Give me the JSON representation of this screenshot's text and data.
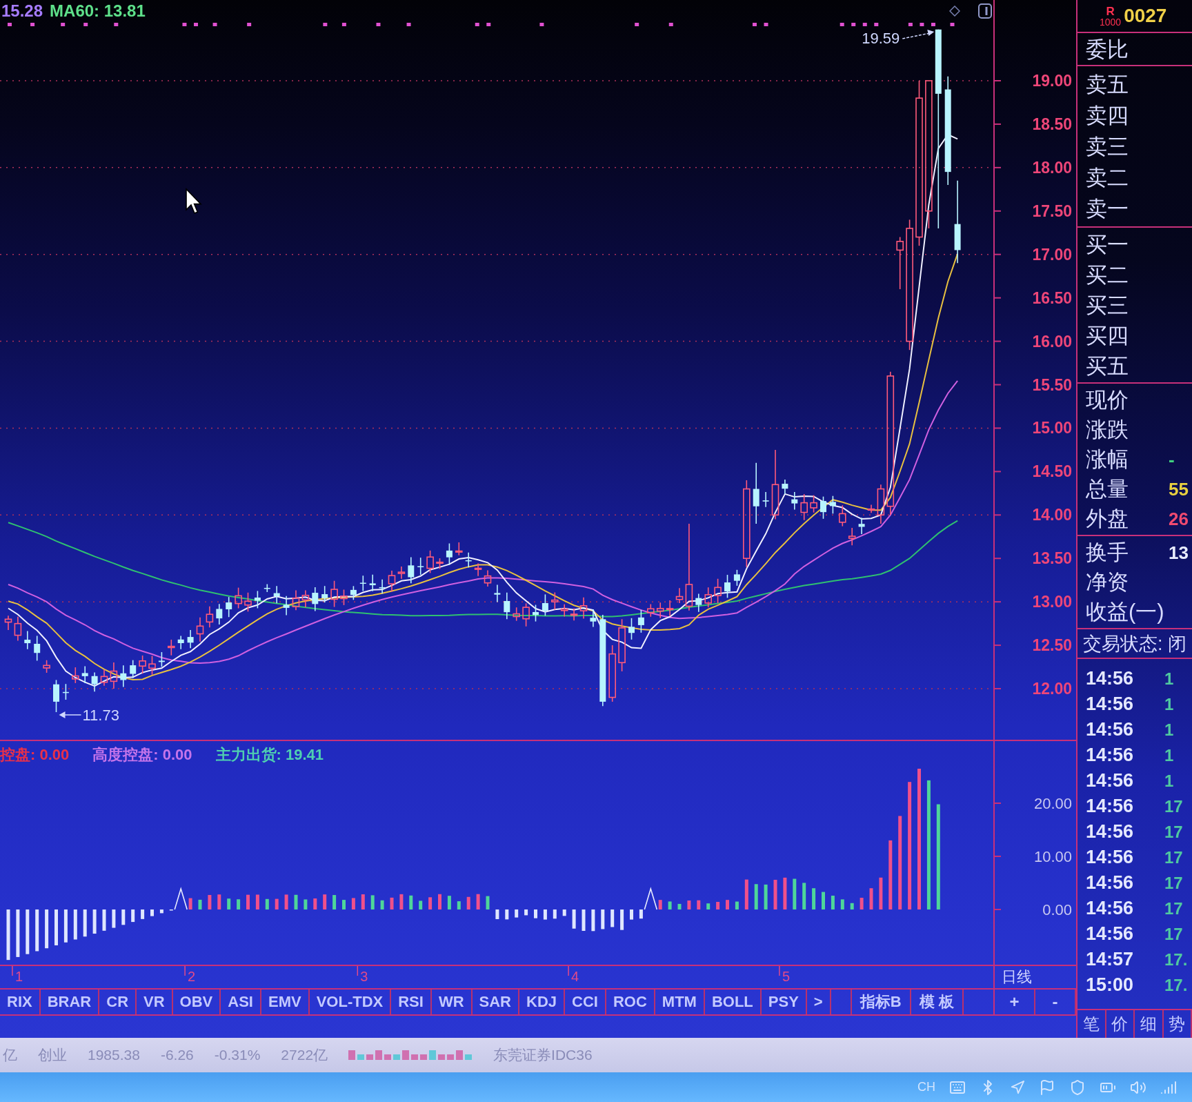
{
  "chart_header": {
    "ma_reading": "15.28",
    "ma60_reading": "MA60: 13.81"
  },
  "price_chart": {
    "axis_labels": [
      "19.00",
      "18.50",
      "18.00",
      "17.50",
      "17.00",
      "16.50",
      "16.00",
      "15.50",
      "15.00",
      "14.50",
      "14.00",
      "13.50",
      "13.00",
      "12.50",
      "12.00"
    ],
    "high_label": "19.59",
    "low_label": "11.73"
  },
  "indicator": {
    "legend": [
      {
        "text": "控盘: 0.00",
        "color": "#e8304a"
      },
      {
        "text": "高度控盘: 0.00",
        "color": "#c474ea"
      },
      {
        "text": "主力出货: 19.41",
        "color": "#4fd0b0"
      }
    ],
    "axis_labels": [
      "20.00",
      "10.00",
      "0.00"
    ]
  },
  "date_axis": {
    "months": [
      "1",
      "2",
      "3",
      "4",
      "5"
    ],
    "period": "日线"
  },
  "toolbar": {
    "tabs": [
      {
        "label": "RIX",
        "selected": false
      },
      {
        "label": "BRAR",
        "selected": false
      },
      {
        "label": "CR",
        "selected": false
      },
      {
        "label": "VR",
        "selected": false
      },
      {
        "label": "OBV",
        "selected": false
      },
      {
        "label": "ASI",
        "selected": false
      },
      {
        "label": "EMV",
        "selected": false
      },
      {
        "label": "VOL-TDX",
        "selected": false
      },
      {
        "label": "RSI",
        "selected": false
      },
      {
        "label": "WR",
        "selected": false
      },
      {
        "label": "SAR",
        "selected": false
      },
      {
        "label": "KDJ",
        "selected": false
      },
      {
        "label": "CCI",
        "selected": false
      },
      {
        "label": "ROC",
        "selected": false
      },
      {
        "label": "MTM",
        "selected": false
      },
      {
        "label": "BOLL",
        "selected": false
      },
      {
        "label": "PSY",
        "selected": false
      }
    ],
    "scroll": ">",
    "buttons": [
      "指标B",
      "模 板"
    ],
    "zoom": [
      "+",
      "-"
    ]
  },
  "quote_panel": {
    "code_marker": "R",
    "code_unit": "1000",
    "code": "0027",
    "ratio_label": "委比",
    "asks": [
      "卖五",
      "卖四",
      "卖三",
      "卖二",
      "卖一"
    ],
    "bids": [
      "买一",
      "买二",
      "买三",
      "买四",
      "买五"
    ],
    "quotes": [
      {
        "label": "现价"
      },
      {
        "label": "涨跌"
      },
      {
        "label": "涨幅",
        "value": "-",
        "color": "#40d080"
      },
      {
        "label": "总量",
        "value": "55",
        "color": "#e8d040"
      },
      {
        "label": "外盘",
        "value": "26",
        "color": "#f04a70"
      }
    ],
    "stats": [
      {
        "label": "换手",
        "value": "13",
        "color": "#e8ecff"
      },
      {
        "label": "净资"
      },
      {
        "label": "收益(一)"
      }
    ],
    "trade_status": "交易状态: 闭",
    "ticks": [
      {
        "time": "14:56",
        "price": "1"
      },
      {
        "time": "14:56",
        "price": "1"
      },
      {
        "time": "14:56",
        "price": "1"
      },
      {
        "time": "14:56",
        "price": "1"
      },
      {
        "time": "14:56",
        "price": "1"
      },
      {
        "time": "14:56",
        "price": "17"
      },
      {
        "time": "14:56",
        "price": "17"
      },
      {
        "time": "14:56",
        "price": "17"
      },
      {
        "time": "14:56",
        "price": "17"
      },
      {
        "time": "14:56",
        "price": "17"
      },
      {
        "time": "14:56",
        "price": "17"
      },
      {
        "time": "14:57",
        "price": "17."
      },
      {
        "time": "15:00",
        "price": "17."
      }
    ],
    "tabs": [
      {
        "label": "笔",
        "selected": false
      },
      {
        "label": "价",
        "selected": false
      },
      {
        "label": "细",
        "selected": false
      },
      {
        "label": "势",
        "selected": false
      }
    ]
  },
  "status_bar": {
    "items": [
      "亿",
      "创业",
      "1985.38",
      "-6.26",
      "-0.31%",
      "2722亿"
    ],
    "broker": "东莞证券IDC36"
  },
  "taskbar": {
    "language": "CH"
  }
}
